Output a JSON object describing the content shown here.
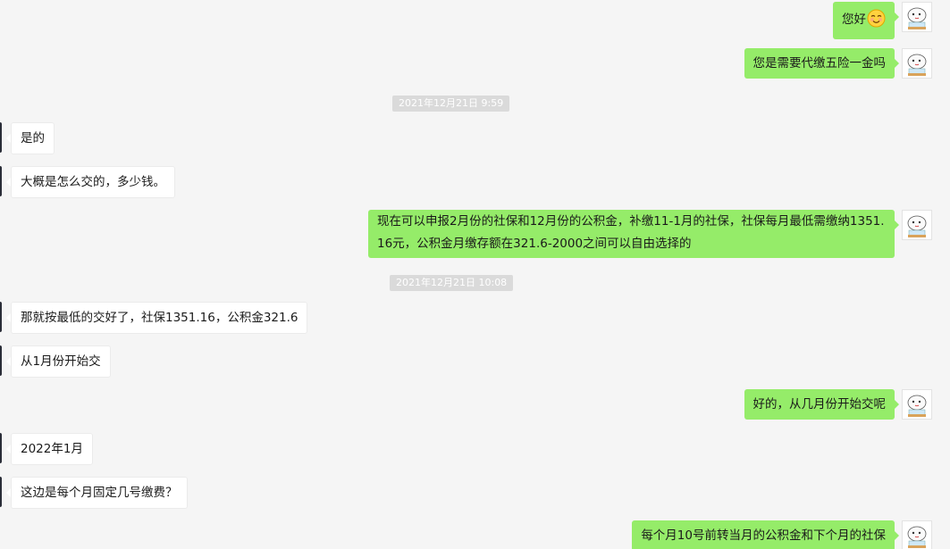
{
  "messages": [
    {
      "side": "out",
      "text": "您好",
      "emoji": "smile-emoji"
    },
    {
      "side": "out",
      "text": "您是需要代缴五险一金吗"
    },
    {
      "side": "time",
      "text": "2021年12月21日 9:59"
    },
    {
      "side": "in",
      "text": "是的"
    },
    {
      "side": "in",
      "text": "大概是怎么交的，多少钱。"
    },
    {
      "side": "out",
      "text": "现在可以申报2月份的社保和12月份的公积金，补缴11-1月的社保，社保每月最低需缴纳1351.16元，公积金月缴存额在321.6-2000之间可以自由选择的"
    },
    {
      "side": "time",
      "text": "2021年12月21日 10:08"
    },
    {
      "side": "in",
      "text": "那就按最低的交好了，社保1351.16，公积金321.6"
    },
    {
      "side": "in",
      "text": "从1月份开始交"
    },
    {
      "side": "out",
      "text": "好的，从几月份开始交呢"
    },
    {
      "side": "in",
      "text": "2022年1月"
    },
    {
      "side": "in",
      "text": "这边是每个月固定几号缴费？"
    },
    {
      "side": "out",
      "text": "每个月10号前转当月的公积金和下个月的社保"
    }
  ],
  "colors": {
    "background": "#f5f5f5",
    "outgoing_bubble": "#95ec69",
    "incoming_bubble": "#ffffff",
    "timestamp_bg": "#dadada"
  }
}
